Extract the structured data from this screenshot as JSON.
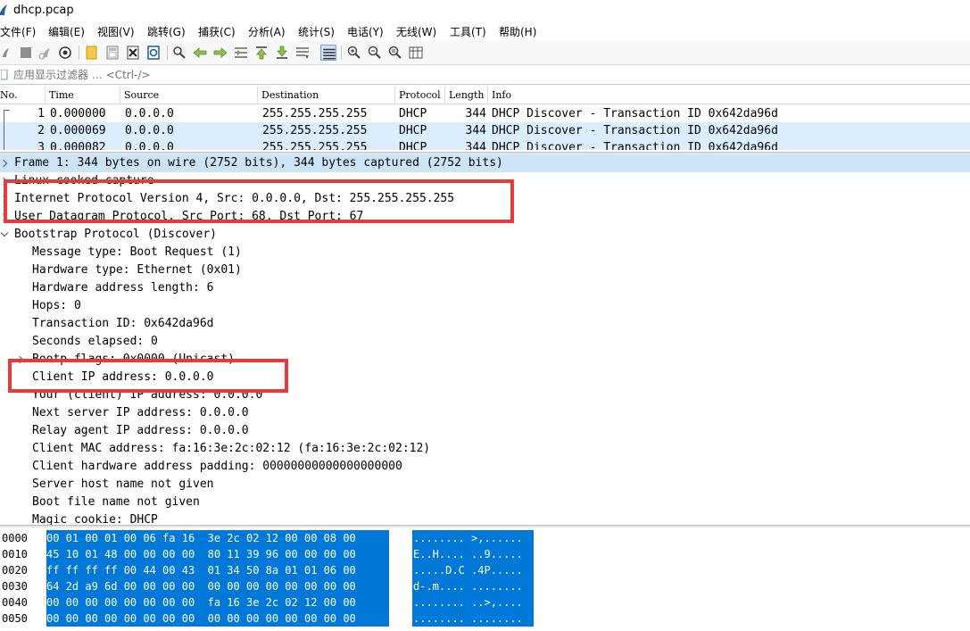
{
  "window": {
    "title": "dhcp.pcap"
  },
  "menu": [
    "文件(F)",
    "编辑(E)",
    "视图(V)",
    "跳转(G)",
    "捕获(C)",
    "分析(A)",
    "统计(S)",
    "电话(Y)",
    "无线(W)",
    "工具(T)",
    "帮助(H)"
  ],
  "toolbar": {
    "icons": [
      "start-capture-icon",
      "stop-capture-icon",
      "restart-capture-icon",
      "capture-options-icon",
      "open-file-icon",
      "save-file-icon",
      "close-file-icon",
      "reload-file-icon",
      "find-packet-icon",
      "go-back-icon",
      "go-forward-icon",
      "go-to-packet-icon",
      "first-packet-icon",
      "last-packet-icon",
      "auto-scroll-icon",
      "colorize-icon",
      "zoom-in-icon",
      "zoom-out-icon",
      "normal-size-icon",
      "resize-columns-icon"
    ]
  },
  "filter": {
    "placeholder": "应用显示过滤器 … <Ctrl-/>"
  },
  "packet_list": {
    "columns": [
      "No.",
      "Time",
      "Source",
      "Destination",
      "Protocol",
      "Length",
      "Info"
    ],
    "rows": [
      {
        "no": "1",
        "time": "0.000000",
        "source": "0.0.0.0",
        "destination": "255.255.255.255",
        "protocol": "DHCP",
        "length": "344",
        "info": "DHCP Discover - Transaction ID 0x642da96d"
      },
      {
        "no": "2",
        "time": "0.000069",
        "source": "0.0.0.0",
        "destination": "255.255.255.255",
        "protocol": "DHCP",
        "length": "344",
        "info": "DHCP Discover - Transaction ID 0x642da96d"
      },
      {
        "no": "3",
        "time": "0.000082",
        "source": "0.0.0.0",
        "destination": "255.255.255.255",
        "protocol": "DHCP",
        "length": "344",
        "info": "DHCP Discover - Transaction ID 0x642da96d"
      }
    ]
  },
  "details": {
    "lines": [
      {
        "text": "Frame 1: 344 bytes on wire (2752 bits), 344 bytes captured (2752 bits)",
        "expander": "right",
        "selected": true
      },
      {
        "text": "Linux cooked capture",
        "expander": "right",
        "selected": false
      },
      {
        "text": "Internet Protocol Version 4, Src: 0.0.0.0, Dst: 255.255.255.255",
        "expander": "right",
        "selected": false
      },
      {
        "text": "User Datagram Protocol, Src Port: 68, Dst Port: 67",
        "expander": "right",
        "selected": false
      },
      {
        "text": "Bootstrap Protocol (Discover)",
        "expander": "down",
        "selected": false
      },
      {
        "text": "Message type: Boot Request (1)",
        "expander": "none",
        "selected": false
      },
      {
        "text": "Hardware type: Ethernet (0x01)",
        "expander": "none",
        "selected": false
      },
      {
        "text": "Hardware address length: 6",
        "expander": "none",
        "selected": false
      },
      {
        "text": "Hops: 0",
        "expander": "none",
        "selected": false
      },
      {
        "text": "Transaction ID: 0x642da96d",
        "expander": "none",
        "selected": false
      },
      {
        "text": "Seconds elapsed: 0",
        "expander": "none",
        "selected": false
      },
      {
        "text": "Bootp flags: 0x0000 (Unicast)",
        "expander": "right",
        "selected": false
      },
      {
        "text": "Client IP address: 0.0.0.0",
        "expander": "none",
        "selected": false
      },
      {
        "text": "Your (client) IP address: 0.0.0.0",
        "expander": "none",
        "selected": false
      },
      {
        "text": "Next server IP address: 0.0.0.0",
        "expander": "none",
        "selected": false
      },
      {
        "text": "Relay agent IP address: 0.0.0.0",
        "expander": "none",
        "selected": false
      },
      {
        "text": "Client MAC address: fa:16:3e:2c:02:12 (fa:16:3e:2c:02:12)",
        "expander": "none",
        "selected": false
      },
      {
        "text": "Client hardware address padding: 00000000000000000000",
        "expander": "none",
        "selected": false
      },
      {
        "text": "Server host name not given",
        "expander": "none",
        "selected": false
      },
      {
        "text": "Boot file name not given",
        "expander": "none",
        "selected": false
      },
      {
        "text": "Magic cookie: DHCP",
        "expander": "none",
        "selected": false
      }
    ]
  },
  "bytes": {
    "rows": [
      {
        "offset": "0000",
        "hex": "00 01 00 01 00 06 fa 16  3e 2c 02 12 00 00 08 00",
        "ascii": "........ >,......"
      },
      {
        "offset": "0010",
        "hex": "45 10 01 48 00 00 00 00  80 11 39 96 00 00 00 00",
        "ascii": "E..H.... ..9....."
      },
      {
        "offset": "0020",
        "hex": "ff ff ff ff 00 44 00 43  01 34 50 8a 01 01 06 00",
        "ascii": ".....D.C .4P....."
      },
      {
        "offset": "0030",
        "hex": "64 2d a9 6d 00 00 00 00  00 00 00 00 00 00 00 00",
        "ascii": "d-.m.... ........"
      },
      {
        "offset": "0040",
        "hex": "00 00 00 00 00 00 00 00  fa 16 3e 2c 02 12 00 00",
        "ascii": "........ ..>,...."
      },
      {
        "offset": "0050",
        "hex": "00 00 00 00 00 00 00 00  00 00 00 00 00 00 00 00",
        "ascii": "........ ........"
      }
    ]
  },
  "colors": {
    "selection": "#0078d7",
    "row_highlight": "#daeeff",
    "detail_selected": "#cce4f7",
    "annotation_red": "#e63b3b"
  }
}
